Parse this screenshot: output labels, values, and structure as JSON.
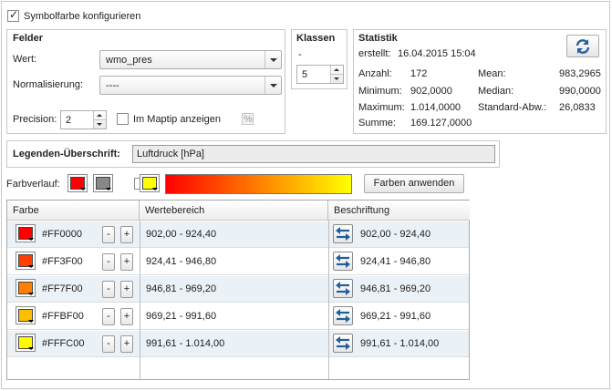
{
  "header": {
    "configure_label": "Symbolfarbe konfigurieren",
    "configure_checked": true
  },
  "felder": {
    "legend": "Felder",
    "wert_label": "Wert:",
    "wert_value": "wmo_pres",
    "norm_label": "Normalisierung:",
    "norm_value": "----",
    "precision_label": "Precision:",
    "precision_value": "2",
    "maptip_label": "Im Maptip anzeigen",
    "percent_label": "%"
  },
  "klassen": {
    "legend": "Klassen",
    "dash": "-",
    "value": "5"
  },
  "statistik": {
    "legend": "Statistik",
    "created_label": "erstellt:",
    "created_value": "16.04.2015 15:04",
    "left": [
      {
        "label": "Anzahl:",
        "value": "172"
      },
      {
        "label": "Minimum:",
        "value": "902,0000"
      },
      {
        "label": "Maximum:",
        "value": "1.014,0000"
      },
      {
        "label": "Summe:",
        "value": "169.127,0000"
      }
    ],
    "right": [
      {
        "label": "Mean:",
        "value": "983,2965"
      },
      {
        "label": "Median:",
        "value": "990,0000"
      },
      {
        "label": "Standard-Abw.:",
        "value": "26,0833"
      }
    ],
    "refresh_icon": "refresh-icon"
  },
  "legende": {
    "label": "Legenden-Überschrift:",
    "value": "Luftdruck [hPa]"
  },
  "farbverlauf": {
    "label": "Farbverlauf:",
    "start_color": "#FF0000",
    "mid_color": "#888888",
    "end_color": "#FFFF00",
    "apply_label": "Farben anwenden"
  },
  "table": {
    "headers": [
      "Farbe",
      "Wertebereich",
      "Beschriftung"
    ],
    "minus": "-",
    "plus": "+",
    "rows": [
      {
        "color": "#FF0000",
        "range": "902,00 - 924,40",
        "caption": "902,00 - 924,40"
      },
      {
        "color": "#FF3F00",
        "range": "924,41 - 946,80",
        "caption": "924,41 - 946,80"
      },
      {
        "color": "#FF7F00",
        "range": "946,81 - 969,20",
        "caption": "946,81 - 969,20"
      },
      {
        "color": "#FFBF00",
        "range": "969,21 - 991,60",
        "caption": "969,21 - 991,60"
      },
      {
        "color": "#FFFC00",
        "range": "991,61 - 1.014,00",
        "caption": "991,61 - 1.014,00"
      }
    ]
  }
}
